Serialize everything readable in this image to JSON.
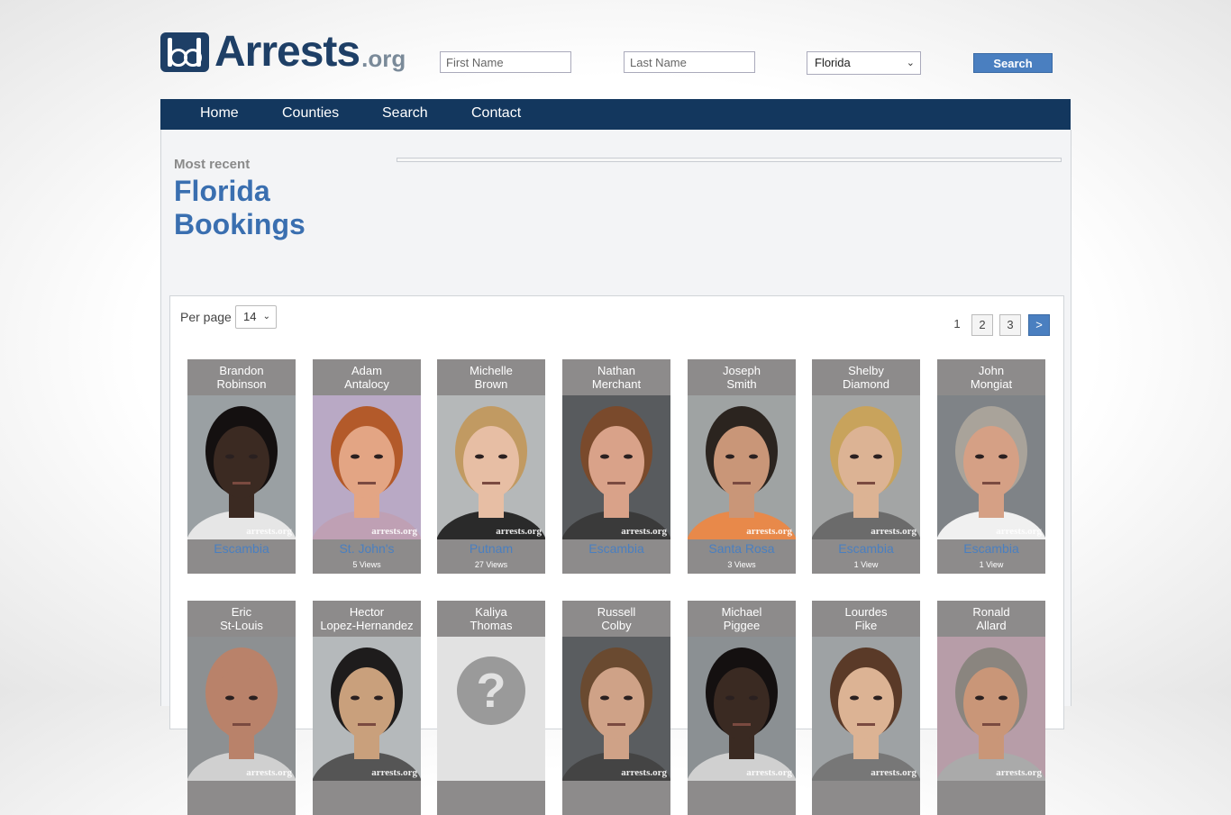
{
  "logo": {
    "main": "Arrests",
    "suffix": ".org"
  },
  "search": {
    "first_placeholder": "First Name",
    "last_placeholder": "Last Name",
    "state_selected": "Florida",
    "button_label": "Search"
  },
  "nav": [
    "Home",
    "Counties",
    "Search",
    "Contact"
  ],
  "heading": {
    "eyebrow": "Most recent",
    "line1": "Florida",
    "line2": "Bookings"
  },
  "controls": {
    "per_page_label": "Per page",
    "per_page_value": "14"
  },
  "pagination": {
    "current": "1",
    "pages": [
      "2",
      "3"
    ],
    "next": ">"
  },
  "watermark": "arrests.org",
  "bookings": [
    {
      "first": "Brandon",
      "last": "Robinson",
      "county": "Escambia",
      "views": "",
      "skin": "#3b2a22",
      "hair": "#141010",
      "bg": "#9aa0a3",
      "shirt": "#e6e6e6"
    },
    {
      "first": "Adam",
      "last": "Antalocy",
      "county": "St. John's",
      "views": "5 Views",
      "skin": "#e3a584",
      "hair": "#b35a2a",
      "bg": "#b9a9c5",
      "shirt": "#bfa0b4"
    },
    {
      "first": "Michelle",
      "last": "Brown",
      "county": "Putnam",
      "views": "27 Views",
      "skin": "#e7bea4",
      "hair": "#c19a62",
      "bg": "#b5b8b9",
      "shirt": "#2a2a2a"
    },
    {
      "first": "Nathan",
      "last": "Merchant",
      "county": "Escambia",
      "views": "",
      "skin": "#d9a289",
      "hair": "#7a4a2c",
      "bg": "#585b5e",
      "shirt": "#3a3a3a"
    },
    {
      "first": "Joseph",
      "last": "Smith",
      "county": "Santa Rosa",
      "views": "3 Views",
      "skin": "#c99678",
      "hair": "#2b241f",
      "bg": "#9fa3a3",
      "shirt": "#e8894a"
    },
    {
      "first": "Shelby",
      "last": "Diamond",
      "county": "Escambia",
      "views": "1 View",
      "skin": "#dcb394",
      "hair": "#c8a35c",
      "bg": "#a3a5a5",
      "shirt": "#6b6b6b"
    },
    {
      "first": "John",
      "last": "Mongiat",
      "county": "Escambia",
      "views": "1 View",
      "skin": "#d5a085",
      "hair": "#a9a39a",
      "bg": "#7f8387",
      "shirt": "#f0f0f0"
    },
    {
      "first": "Eric",
      "last": "St-Louis",
      "county": "",
      "views": "",
      "skin": "#b9826a",
      "hair": "#b9826a",
      "bg": "#8d9092",
      "shirt": "#d0d0d0"
    },
    {
      "first": "Hector",
      "last": "Lopez-Hernandez",
      "county": "",
      "views": "",
      "skin": "#c9a07c",
      "hair": "#1e1c1c",
      "bg": "#b5b9bb",
      "shirt": "#555"
    },
    {
      "first": "Kaliya",
      "last": "Thomas",
      "county": "",
      "views": "",
      "skin": "#9a9a9a",
      "hair": "#9a9a9a",
      "bg": "#e2e2e2",
      "shirt": "#e2e2e2",
      "placeholder": "?"
    },
    {
      "first": "Russell",
      "last": "Colby",
      "county": "",
      "views": "",
      "skin": "#cfa287",
      "hair": "#6a4a30",
      "bg": "#5a5d60",
      "shirt": "#444"
    },
    {
      "first": "Michael",
      "last": "Piggee",
      "county": "",
      "views": "",
      "skin": "#3a2a22",
      "hair": "#141010",
      "bg": "#8b9093",
      "shirt": "#d0d0d0"
    },
    {
      "first": "Lourdes",
      "last": "Fike",
      "county": "",
      "views": "",
      "skin": "#dcb394",
      "hair": "#5a3a28",
      "bg": "#9ea2a4",
      "shirt": "#777"
    },
    {
      "first": "Ronald",
      "last": "Allard",
      "county": "",
      "views": "",
      "skin": "#c99678",
      "hair": "#8a857f",
      "bg": "#b79da8",
      "shirt": "#aaa"
    }
  ]
}
